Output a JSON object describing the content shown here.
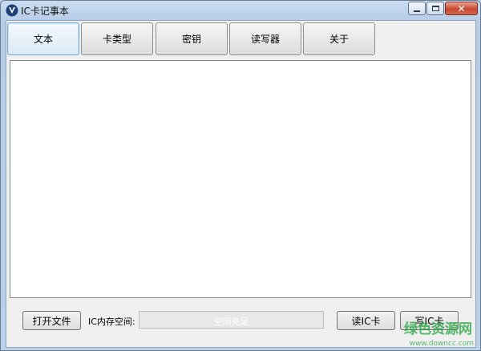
{
  "window": {
    "title": "IC卡记事本",
    "controls": {
      "minimize": "minimize-icon",
      "maximize": "maximize-icon",
      "close": "close-icon"
    }
  },
  "tabs": [
    {
      "label": "文本",
      "active": true
    },
    {
      "label": "卡类型",
      "active": false
    },
    {
      "label": "密钥",
      "active": false
    },
    {
      "label": "读写器",
      "active": false
    },
    {
      "label": "关于",
      "active": false
    }
  ],
  "editor": {
    "value": ""
  },
  "footer": {
    "open_file_label": "打开文件",
    "memory_label": "IC内存空间:",
    "memory_status": "空间充足",
    "memory_used_fraction": 0,
    "read_card_label": "读IC卡",
    "write_card_label": "写IC卡"
  },
  "watermark": {
    "line1": "绿色资源网",
    "line2": "www.downcc.com"
  },
  "colors": {
    "accent": "#6aa9d8",
    "watermark": "#1fa23a",
    "close": "#c7462f"
  }
}
